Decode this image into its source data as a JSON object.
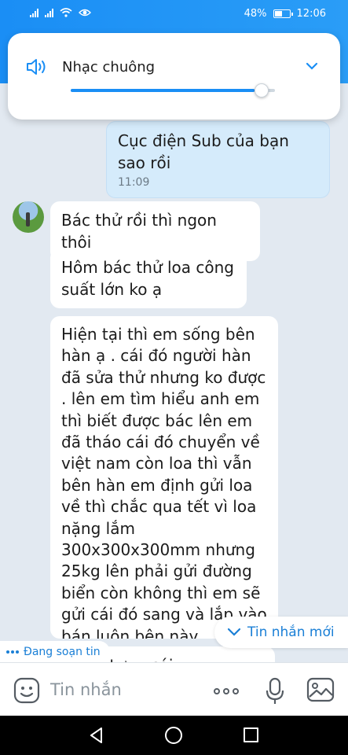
{
  "status_bar": {
    "battery": "48%",
    "time": "12:06"
  },
  "volume_panel": {
    "title": "Nhạc chuông",
    "level": 0.9
  },
  "messages": [
    {
      "sender": "me",
      "text": "Cục điện Sub của bạn sao rồi",
      "time": "11:09"
    },
    {
      "sender": "other",
      "text": "Bác thử rồi thì ngon thôi"
    },
    {
      "sender": "other",
      "text": "Hôm bác thử loa công suất lớn ko ạ"
    },
    {
      "sender": "other",
      "text": "Hiện tại thì em sống bên hàn ạ .  cái đó người hàn đã sửa thử nhưng ko được .  lên em tìm hiểu anh em thì biết được bác lên em đã tháo cái đó chuyển về việt nam   còn loa thì vẫn bên hàn   em định gửi loa về thì chắc qua tết  vì loa nặng lắm 300x300x300mm  nhưng 25kg  lên phải gửi đường biển     còn không  thì em sẽ gửi cái đó sang và lắp vào bán luôn bên này"
    },
    {
      "sender": "other",
      "text": "...bác tự ... cái"
    }
  ],
  "new_message_label": "Tin nhắn mới",
  "typing_label": "Đang soạn tin",
  "input": {
    "placeholder": "Tin nhắn"
  },
  "colors": {
    "accent": "#1a8ef5",
    "my_bubble": "#d5ebfb",
    "chat_bg": "#e2e9f1"
  }
}
